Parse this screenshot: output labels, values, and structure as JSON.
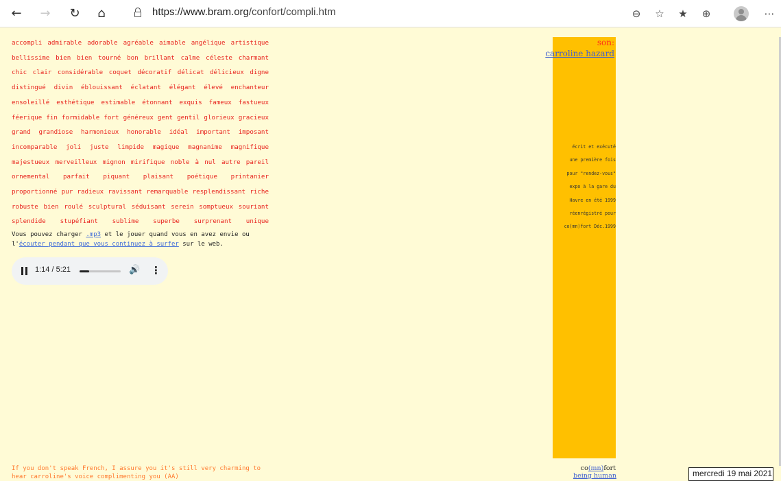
{
  "browser": {
    "url_host": "https://www.bram.org",
    "url_path": "/confort/compli.htm",
    "icons": [
      "back-icon",
      "forward-icon",
      "refresh-icon",
      "home-icon",
      "lock-icon",
      "zoom-icon",
      "add-favorite-icon",
      "favorites-icon",
      "collections-icon",
      "profile-icon",
      "more-icon"
    ]
  },
  "words": [
    "accompli admirable adorable agréable  aimable angélique  artistique",
    "bellissime  bien  bien tourné  bon  brillant calme céleste charmant",
    "chic  clair  considérable coquet décoratif  délicat délicieux digne",
    "distingué  divin  éblouissant  éclatant  élégant  élevé  enchanteur",
    "ensoleillé  esthétique  estimable  étonnant exquis  fameux fastueux",
    "féerique fin formidable fort généreux gent gentil glorieux gracieux",
    "grand  grandiose  harmonieux  honorable  idéal  important  imposant",
    "incomparable  joli  juste  limpide   magique  magnanime  magnifique",
    "majestueux merveilleux mignon mirifique noble    à nul autre pareil",
    "ornemental    parfait   piquant   plaisant   poétique    printanier",
    "proportionné pur radieux ravissant remarquable resplendissant riche",
    "robuste   bien roulé  sculptural séduisant serein somptueux souriant",
    "splendide  stupéfiant  sublime  superbe  surprenant            unique"
  ],
  "paragraph": {
    "part1": "Vous pouvez charger ",
    "mp3_link": ".mp3",
    "part2": " et le jouer quand vous en avez envie ou l'",
    "listen_link": "écouter pendant que vous continuez à surfer",
    "part3": " sur le web."
  },
  "player": {
    "time": "1:14 / 5:21",
    "progress_fraction": 0.231,
    "icons": [
      "pause-icon",
      "volume-icon",
      "more-vertical-icon"
    ]
  },
  "bottom_note": "If you don't speak French, I assure you it's still very charming to hear carroline's voice complimenting you (AA)",
  "column": {
    "son_label": "son:",
    "author_link": "carroline hazard",
    "credits": [
      "écrit et exécuté",
      "une première fois",
      "pour \"rendez-vous\"",
      "expo à la gare du",
      "Havre en été 1999",
      "réenrégistré pour",
      "co(mn)fort Déc.1999"
    ]
  },
  "footer": {
    "co": "co",
    "mn_link": "(mn)",
    "fort": "fort",
    "being_human": "being human"
  },
  "date": "mercredi 19 mai 2021",
  "colors": {
    "background": "#fffbd6",
    "words": "#e8251f",
    "column": "#ffc000",
    "link": "#3f5fd0",
    "note": "#ff7a2e"
  }
}
